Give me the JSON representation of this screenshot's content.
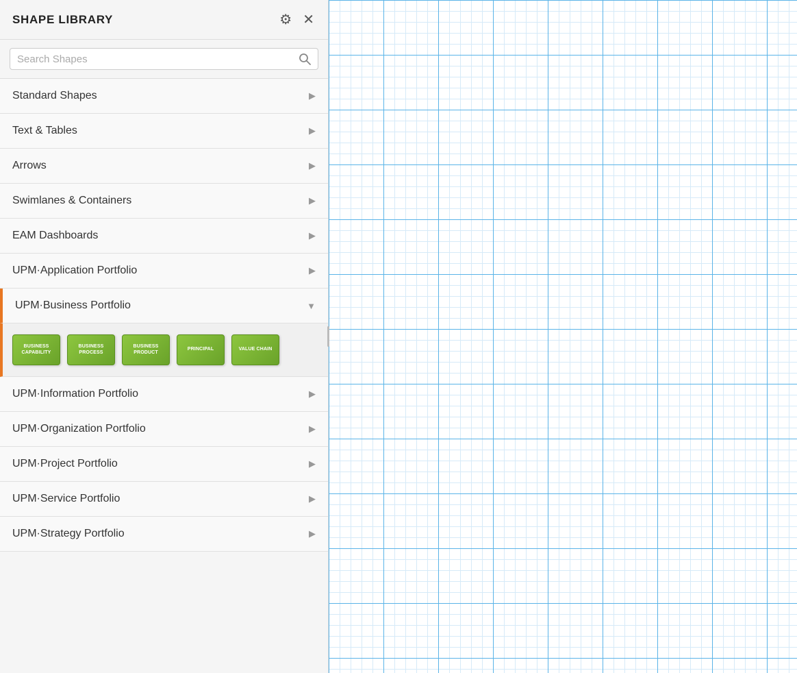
{
  "sidebar": {
    "title": "SHAPE LIBRARY",
    "search": {
      "placeholder": "Search Shapes"
    },
    "menu_items": [
      {
        "id": "standard-shapes",
        "label": "Standard Shapes",
        "expanded": false,
        "chevron": "right"
      },
      {
        "id": "text-tables",
        "label": "Text & Tables",
        "expanded": false,
        "chevron": "right"
      },
      {
        "id": "arrows",
        "label": "Arrows",
        "expanded": false,
        "chevron": "right"
      },
      {
        "id": "swimlanes-containers",
        "label": "Swimlanes & Containers",
        "expanded": false,
        "chevron": "right"
      },
      {
        "id": "eam-dashboards",
        "label": "EAM Dashboards",
        "expanded": false,
        "chevron": "right"
      },
      {
        "id": "upm-application",
        "label": "UPM·Application Portfolio",
        "expanded": false,
        "chevron": "right"
      },
      {
        "id": "upm-business",
        "label": "UPM·Business Portfolio",
        "expanded": true,
        "chevron": "down"
      },
      {
        "id": "upm-information",
        "label": "UPM·Information Portfolio",
        "expanded": false,
        "chevron": "right"
      },
      {
        "id": "upm-organization",
        "label": "UPM·Organization Portfolio",
        "expanded": false,
        "chevron": "right"
      },
      {
        "id": "upm-project",
        "label": "UPM·Project Portfolio",
        "expanded": false,
        "chevron": "right"
      },
      {
        "id": "upm-service",
        "label": "UPM·Service Portfolio",
        "expanded": false,
        "chevron": "right"
      },
      {
        "id": "upm-strategy",
        "label": "UPM·Strategy Portfolio",
        "expanded": false,
        "chevron": "right"
      }
    ],
    "expanded_shapes": [
      {
        "id": "business-capability",
        "label": "BUSINESS CAPABILITY"
      },
      {
        "id": "business-process",
        "label": "BUSINESS PROCESS"
      },
      {
        "id": "business-product",
        "label": "BUSINESS PRODUCT"
      },
      {
        "id": "principal",
        "label": "PRINCIPAL"
      },
      {
        "id": "value-chain",
        "label": "VALUE CHAIN"
      }
    ]
  },
  "icons": {
    "gear": "⚙",
    "close": "✕",
    "search": "🔍",
    "chevron_right": "▶",
    "chevron_down": "▼"
  }
}
